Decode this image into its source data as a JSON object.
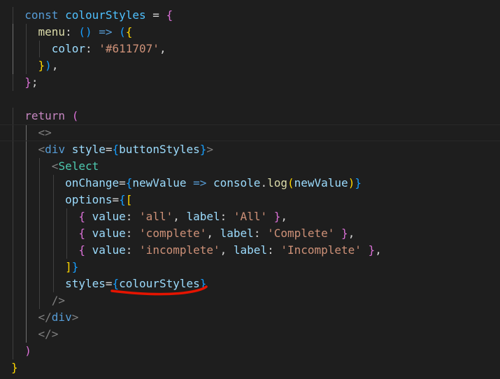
{
  "editor": {
    "language": "javascript-react",
    "colors": {
      "background": "#1e1e1e",
      "keyword": "#569cd6",
      "control": "#c586c0",
      "variable": "#4fc1ff",
      "property": "#9cdcfe",
      "string": "#ce9178",
      "function": "#dcdcaa",
      "component": "#4ec9b0",
      "bracket_gold": "#ffd700",
      "bracket_purple": "#da70d6",
      "bracket_blue": "#179fff",
      "annotation": "#e51400"
    },
    "lines": [
      [
        {
          "t": "  "
        },
        {
          "t": "const",
          "c": "kw"
        },
        {
          "t": " "
        },
        {
          "t": "colourStyles",
          "c": "var"
        },
        {
          "t": " = ",
          "c": "op"
        },
        {
          "t": "{",
          "c": "b2"
        }
      ],
      [
        {
          "t": "    "
        },
        {
          "t": "menu",
          "c": "fn"
        },
        {
          "t": ": ",
          "c": "op"
        },
        {
          "t": "()",
          "c": "b3"
        },
        {
          "t": " => ",
          "c": "kw"
        },
        {
          "t": "(",
          "c": "b3"
        },
        {
          "t": "{",
          "c": "b1"
        }
      ],
      [
        {
          "t": "      "
        },
        {
          "t": "color",
          "c": "prop"
        },
        {
          "t": ": ",
          "c": "op"
        },
        {
          "t": "'#611707'",
          "c": "str"
        },
        {
          "t": ",",
          "c": "op"
        }
      ],
      [
        {
          "t": "    "
        },
        {
          "t": "}",
          "c": "b1"
        },
        {
          "t": ")",
          "c": "b3"
        },
        {
          "t": ",",
          "c": "op"
        }
      ],
      [
        {
          "t": "  "
        },
        {
          "t": "}",
          "c": "b2"
        },
        {
          "t": ";",
          "c": "op"
        }
      ],
      [
        {
          "t": ""
        }
      ],
      [
        {
          "t": "  "
        },
        {
          "t": "return",
          "c": "ctrl"
        },
        {
          "t": " "
        },
        {
          "t": "(",
          "c": "b2"
        }
      ],
      [
        {
          "t": "    "
        },
        {
          "t": "<>",
          "c": "angle"
        }
      ],
      [
        {
          "t": "    "
        },
        {
          "t": "<",
          "c": "angle"
        },
        {
          "t": "div",
          "c": "tag"
        },
        {
          "t": " "
        },
        {
          "t": "style",
          "c": "prop"
        },
        {
          "t": "=",
          "c": "op"
        },
        {
          "t": "{",
          "c": "b3"
        },
        {
          "t": "buttonStyles",
          "c": "prop"
        },
        {
          "t": "}",
          "c": "b3"
        },
        {
          "t": ">",
          "c": "angle"
        }
      ],
      [
        {
          "t": "      "
        },
        {
          "t": "<",
          "c": "angle"
        },
        {
          "t": "Select",
          "c": "comp"
        }
      ],
      [
        {
          "t": "        "
        },
        {
          "t": "onChange",
          "c": "prop"
        },
        {
          "t": "=",
          "c": "op"
        },
        {
          "t": "{",
          "c": "b3"
        },
        {
          "t": "newValue",
          "c": "prop"
        },
        {
          "t": " => ",
          "c": "kw"
        },
        {
          "t": "console",
          "c": "prop"
        },
        {
          "t": ".",
          "c": "op"
        },
        {
          "t": "log",
          "c": "fn"
        },
        {
          "t": "(",
          "c": "b1"
        },
        {
          "t": "newValue",
          "c": "prop"
        },
        {
          "t": ")",
          "c": "b1"
        },
        {
          "t": "}",
          "c": "b3"
        }
      ],
      [
        {
          "t": "        "
        },
        {
          "t": "options",
          "c": "prop"
        },
        {
          "t": "=",
          "c": "op"
        },
        {
          "t": "{",
          "c": "b3"
        },
        {
          "t": "[",
          "c": "b1"
        }
      ],
      [
        {
          "t": "          "
        },
        {
          "t": "{",
          "c": "b2"
        },
        {
          "t": " "
        },
        {
          "t": "value",
          "c": "prop"
        },
        {
          "t": ": ",
          "c": "op"
        },
        {
          "t": "'all'",
          "c": "str"
        },
        {
          "t": ", ",
          "c": "op"
        },
        {
          "t": "label",
          "c": "prop"
        },
        {
          "t": ": ",
          "c": "op"
        },
        {
          "t": "'All'",
          "c": "str"
        },
        {
          "t": " "
        },
        {
          "t": "}",
          "c": "b2"
        },
        {
          "t": ",",
          "c": "op"
        }
      ],
      [
        {
          "t": "          "
        },
        {
          "t": "{",
          "c": "b2"
        },
        {
          "t": " "
        },
        {
          "t": "value",
          "c": "prop"
        },
        {
          "t": ": ",
          "c": "op"
        },
        {
          "t": "'complete'",
          "c": "str"
        },
        {
          "t": ", ",
          "c": "op"
        },
        {
          "t": "label",
          "c": "prop"
        },
        {
          "t": ": ",
          "c": "op"
        },
        {
          "t": "'Complete'",
          "c": "str"
        },
        {
          "t": " "
        },
        {
          "t": "}",
          "c": "b2"
        },
        {
          "t": ",",
          "c": "op"
        }
      ],
      [
        {
          "t": "          "
        },
        {
          "t": "{",
          "c": "b2"
        },
        {
          "t": " "
        },
        {
          "t": "value",
          "c": "prop"
        },
        {
          "t": ": ",
          "c": "op"
        },
        {
          "t": "'incomplete'",
          "c": "str"
        },
        {
          "t": ", ",
          "c": "op"
        },
        {
          "t": "label",
          "c": "prop"
        },
        {
          "t": ": ",
          "c": "op"
        },
        {
          "t": "'Incomplete'",
          "c": "str"
        },
        {
          "t": " "
        },
        {
          "t": "}",
          "c": "b2"
        },
        {
          "t": ",",
          "c": "op"
        }
      ],
      [
        {
          "t": "        "
        },
        {
          "t": "]",
          "c": "b1"
        },
        {
          "t": "}",
          "c": "b3"
        }
      ],
      [
        {
          "t": "        "
        },
        {
          "t": "styles",
          "c": "prop"
        },
        {
          "t": "=",
          "c": "op"
        },
        {
          "t": "{",
          "c": "b3"
        },
        {
          "t": "colourStyles",
          "c": "prop"
        },
        {
          "t": "}",
          "c": "b3"
        }
      ],
      [
        {
          "t": "      "
        },
        {
          "t": "/>",
          "c": "angle"
        }
      ],
      [
        {
          "t": "    "
        },
        {
          "t": "</",
          "c": "angle"
        },
        {
          "t": "div",
          "c": "tag"
        },
        {
          "t": ">",
          "c": "angle"
        }
      ],
      [
        {
          "t": "    "
        },
        {
          "t": "</>",
          "c": "angle"
        }
      ],
      [
        {
          "t": "  "
        },
        {
          "t": ")",
          "c": "b2"
        }
      ],
      [
        {
          "t": "}",
          "c": "b1"
        }
      ]
    ]
  }
}
